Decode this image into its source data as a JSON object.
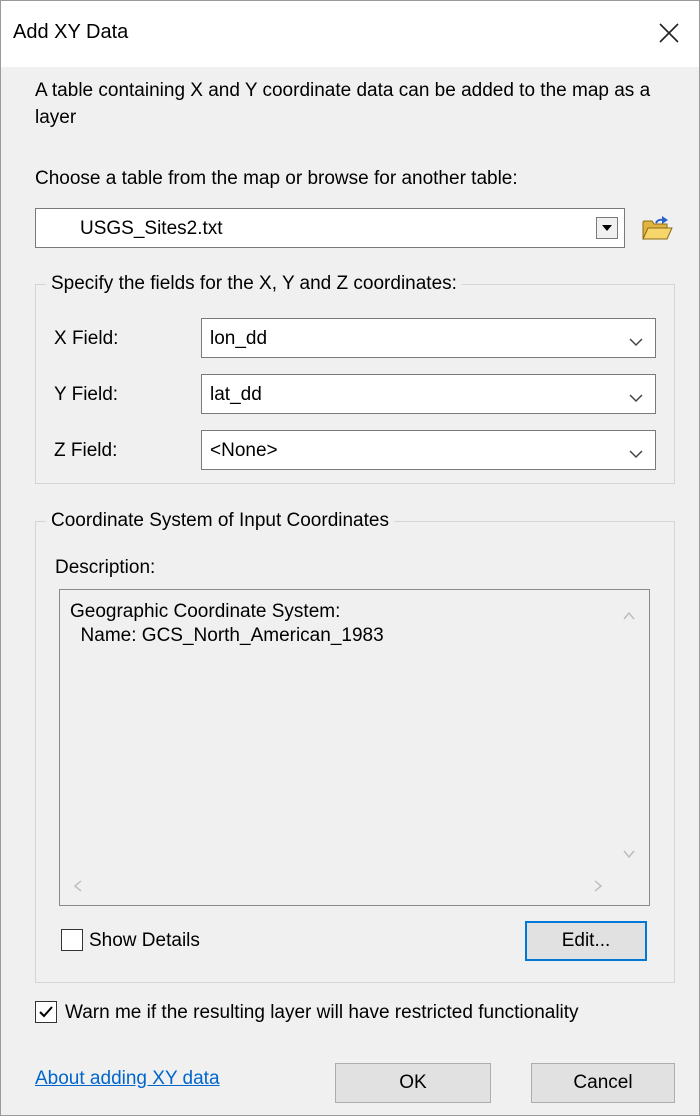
{
  "window": {
    "title": "Add XY Data"
  },
  "intro_text": "A table containing X and Y coordinate data can be added to the map as a layer",
  "table_chooser": {
    "label": "Choose a table from the map or browse for another table:",
    "selected": "USGS_Sites2.txt",
    "icon": "folder-open-icon"
  },
  "fields_group": {
    "label": "Specify the fields for the X, Y and Z coordinates:",
    "x_label": "X Field:",
    "x_value": "lon_dd",
    "y_label": "Y Field:",
    "y_value": "lat_dd",
    "z_label": "Z Field:",
    "z_value": "<None>"
  },
  "coord_group": {
    "label": "Coordinate System of Input Coordinates",
    "description_label": "Description:",
    "description_line1": "Geographic Coordinate System:",
    "description_line2": "  Name: GCS_North_American_1983",
    "show_details_label": "Show Details",
    "show_details_checked": false,
    "edit_label": "Edit..."
  },
  "warn": {
    "label": "Warn me if the resulting layer will have restricted functionality",
    "checked": true
  },
  "footer": {
    "help_link": "About adding XY data",
    "ok_label": "OK",
    "cancel_label": "Cancel"
  },
  "colors": {
    "dialog_bg": "#f0f0f0",
    "link": "#0066cc",
    "focus": "#0078d7"
  }
}
